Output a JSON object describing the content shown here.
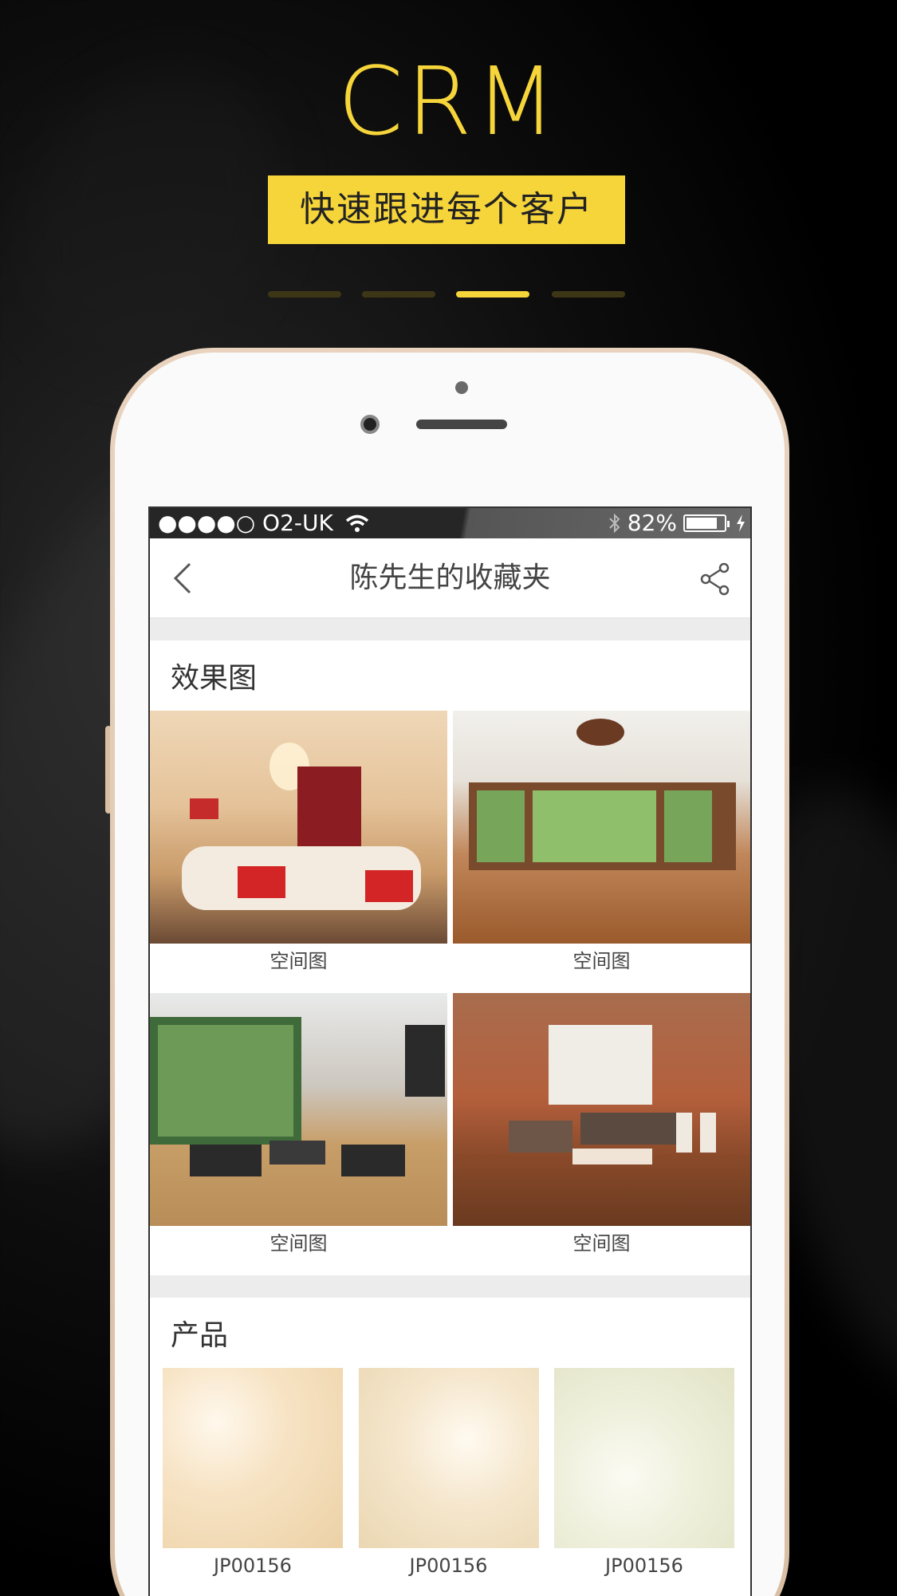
{
  "header": {
    "title": "CRM",
    "banner": "快速跟进每个客户",
    "pager": {
      "count": 4,
      "active_index": 2
    }
  },
  "status_bar": {
    "carrier": "●●●●○ O2-UK",
    "battery": "82%",
    "battery_level": 0.82
  },
  "nav": {
    "title": "陈先生的收藏夹"
  },
  "sections": {
    "effects": {
      "title": "效果图",
      "items": [
        {
          "caption": "空间图"
        },
        {
          "caption": "空间图"
        },
        {
          "caption": "空间图"
        },
        {
          "caption": "空间图"
        }
      ]
    },
    "products": {
      "title": "产品",
      "items": [
        {
          "code": "JP00156"
        },
        {
          "code": "JP00156"
        },
        {
          "code": "JP00156"
        }
      ]
    }
  },
  "colors": {
    "accent": "#f6d53b",
    "background": "#000000",
    "phone_frame": "#e9d3bf"
  }
}
